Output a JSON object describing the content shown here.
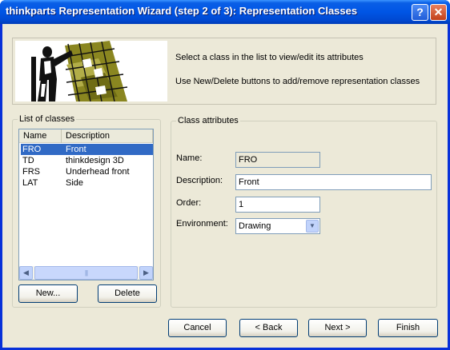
{
  "window": {
    "title": "thinkparts Representation Wizard (step 2 of 3): Representation Classes",
    "help_icon": "?",
    "close_icon": "✕"
  },
  "banner": {
    "line1": "Select a class in the list to view/edit its attributes",
    "line2": "Use New/Delete buttons to add/remove representation classes"
  },
  "list_group": {
    "label": "List of classes",
    "columns": [
      "Name",
      "Description"
    ],
    "rows": [
      {
        "name": "FRO",
        "description": "Front",
        "selected": true
      },
      {
        "name": "TD",
        "description": "thinkdesign 3D",
        "selected": false
      },
      {
        "name": "FRS",
        "description": "Underhead front",
        "selected": false
      },
      {
        "name": "LAT",
        "description": "Side",
        "selected": false
      }
    ],
    "new_button": "New...",
    "delete_button": "Delete"
  },
  "attributes": {
    "label": "Class attributes",
    "name_label": "Name:",
    "name_value": "FRO",
    "description_label": "Description:",
    "description_value": "Front",
    "order_label": "Order:",
    "order_value": "1",
    "environment_label": "Environment:",
    "environment_value": "Drawing"
  },
  "footer": {
    "cancel": "Cancel",
    "back": "< Back",
    "next": "Next >",
    "finish": "Finish"
  },
  "colors": {
    "titlebar": "#0054e3",
    "selection": "#316ac5",
    "dialog_bg": "#ece9d8"
  }
}
